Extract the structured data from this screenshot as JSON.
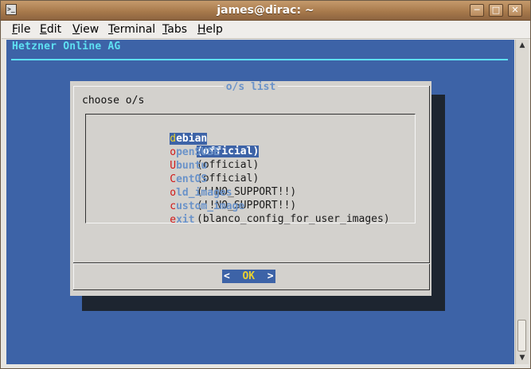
{
  "window": {
    "title": "james@dirac: ~",
    "menu_icon": "terminal-icon",
    "buttons": [
      "minimize-icon",
      "maximize-icon",
      "close-icon"
    ]
  },
  "menubar": {
    "items": [
      {
        "mnemonic": "F",
        "rest": "ile"
      },
      {
        "mnemonic": "E",
        "rest": "dit"
      },
      {
        "mnemonic": "V",
        "rest": "iew"
      },
      {
        "mnemonic": "T",
        "rest": "erminal"
      },
      {
        "mnemonic": "T",
        "rest": "abs"
      },
      {
        "mnemonic": "H",
        "rest": "elp"
      }
    ]
  },
  "terminal": {
    "backtitle": "Hetzner Online AG",
    "dialog": {
      "title": "o/s list",
      "subtitle": "choose o/s",
      "options": [
        {
          "hotkey": "d",
          "rest": "ebian",
          "desc": "(official)"
        },
        {
          "hotkey": "o",
          "rest": "penSUSE",
          "desc": "(official)"
        },
        {
          "hotkey": "U",
          "rest": "buntu",
          "desc": "(official)"
        },
        {
          "hotkey": "C",
          "rest": "entOS",
          "desc": "(!!NO_SUPPORT!!)"
        },
        {
          "hotkey": "o",
          "rest": "ld_images",
          "desc": "(!!NO_SUPPORT!!)"
        },
        {
          "hotkey": "c",
          "rest": "ustom_image",
          "desc": "(blanco_config_for_user_images)"
        },
        {
          "hotkey": "e",
          "rest": "xit",
          "desc": ""
        }
      ],
      "ok_button": {
        "left": "<  ",
        "hotkey": "OK",
        "right": "  >"
      }
    }
  },
  "colors": {
    "terminal_bg": "#3d63a7",
    "backtitle": "#5ee0f2",
    "dialog_bg": "#d3d1cd",
    "hotkey": "#d01818"
  }
}
